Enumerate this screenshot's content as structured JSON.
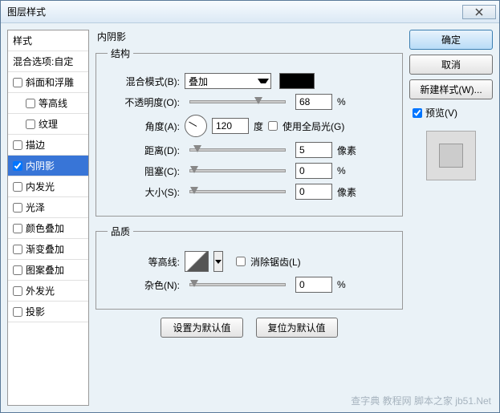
{
  "title": "图层样式",
  "sidebar": {
    "styles_header": "样式",
    "blend_options": "混合选项:自定",
    "items": [
      {
        "label": "斜面和浮雕",
        "checked": false,
        "indent": false
      },
      {
        "label": "等高线",
        "checked": false,
        "indent": true
      },
      {
        "label": "纹理",
        "checked": false,
        "indent": true
      },
      {
        "label": "描边",
        "checked": false,
        "indent": false
      },
      {
        "label": "内阴影",
        "checked": true,
        "indent": false,
        "selected": true
      },
      {
        "label": "内发光",
        "checked": false,
        "indent": false
      },
      {
        "label": "光泽",
        "checked": false,
        "indent": false
      },
      {
        "label": "颜色叠加",
        "checked": false,
        "indent": false
      },
      {
        "label": "渐变叠加",
        "checked": false,
        "indent": false
      },
      {
        "label": "图案叠加",
        "checked": false,
        "indent": false
      },
      {
        "label": "外发光",
        "checked": false,
        "indent": false
      },
      {
        "label": "投影",
        "checked": false,
        "indent": false
      }
    ]
  },
  "panel_title": "内阴影",
  "structure": {
    "legend": "结构",
    "blend_mode_label": "混合模式(B):",
    "blend_mode_value": "叠加",
    "color": "#000000",
    "opacity_label": "不透明度(O):",
    "opacity_value": "68",
    "opacity_unit": "%",
    "angle_label": "角度(A):",
    "angle_value": "120",
    "angle_unit": "度",
    "global_light_label": "使用全局光(G)",
    "global_light_checked": false,
    "distance_label": "距离(D):",
    "distance_value": "5",
    "distance_unit": "像素",
    "choke_label": "阻塞(C):",
    "choke_value": "0",
    "choke_unit": "%",
    "size_label": "大小(S):",
    "size_value": "0",
    "size_unit": "像素"
  },
  "quality": {
    "legend": "品质",
    "contour_label": "等高线:",
    "antialias_label": "消除锯齿(L)",
    "antialias_checked": false,
    "noise_label": "杂色(N):",
    "noise_value": "0",
    "noise_unit": "%"
  },
  "buttons": {
    "set_default": "设置为默认值",
    "reset_default": "复位为默认值"
  },
  "right": {
    "ok": "确定",
    "cancel": "取消",
    "new_style": "新建样式(W)...",
    "preview_label": "预览(V)",
    "preview_checked": true
  },
  "watermark": "查字典 教程网   脚本之家  jb51.Net"
}
